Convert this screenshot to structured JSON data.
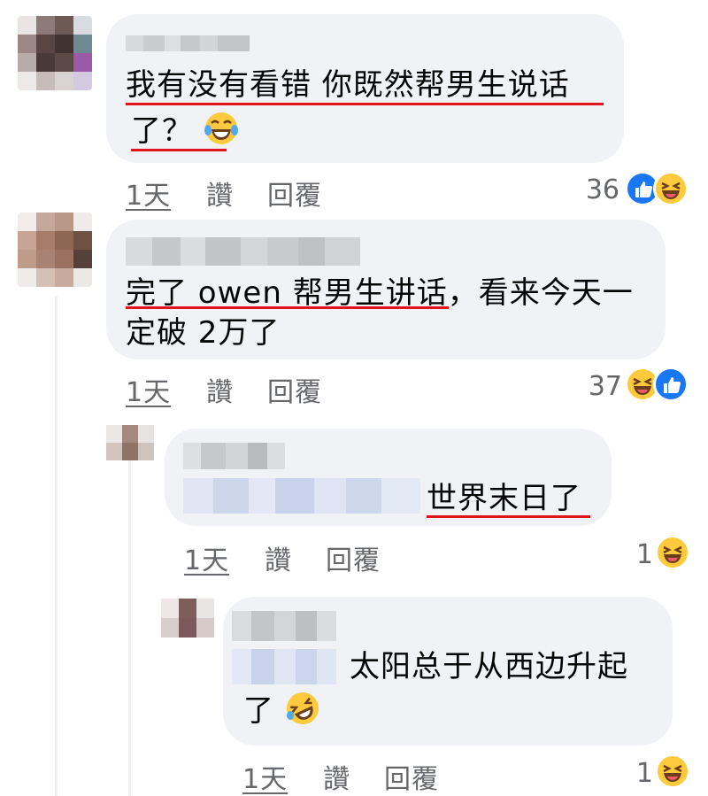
{
  "comments": [
    {
      "text_line1": "我有没有看错 你既然帮男生说话",
      "text_line2": "了？",
      "time": "1天",
      "like": "讚",
      "reply": "回覆",
      "count": "36"
    },
    {
      "text_line1_a": "完了 owen 帮男生讲话",
      "text_line1_b": "，看来今天一",
      "text_line2": "定破 2万了",
      "time": "1天",
      "like": "讚",
      "reply": "回覆",
      "count": "37"
    },
    {
      "text": "世界末日了",
      "time": "1天",
      "like": "讚",
      "reply": "回覆",
      "count": "1"
    },
    {
      "text_line1": "太阳总于从西边升起",
      "text_line2": "了",
      "time": "1天",
      "like": "讚",
      "reply": "回覆",
      "count": "1"
    }
  ],
  "colors": {
    "bubble": "#f0f2f5",
    "underline": "#e0141e",
    "like": "#1877f2",
    "haha": "#fcca3c",
    "meta": "#65676b"
  },
  "icons": [
    "like-reaction-icon",
    "haha-reaction-icon",
    "laughing-tears-emoji",
    "rofl-emoji"
  ]
}
